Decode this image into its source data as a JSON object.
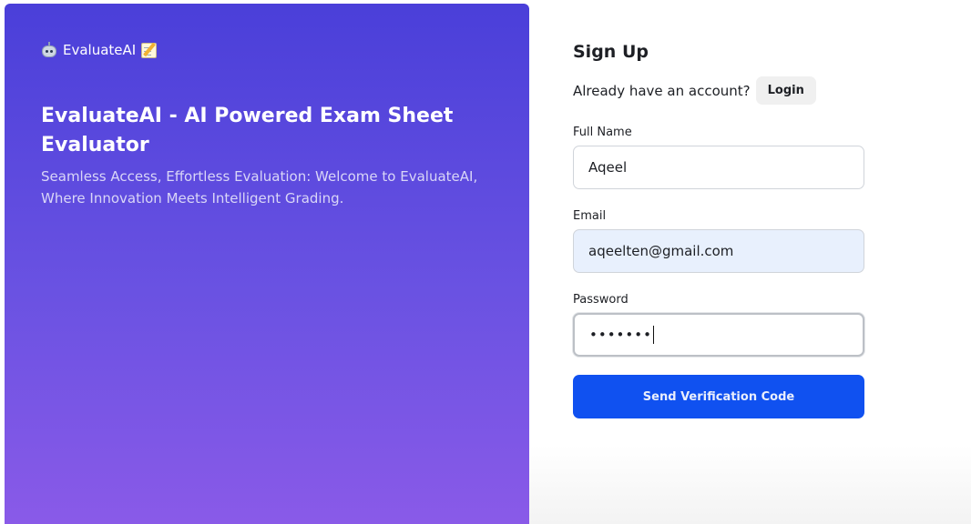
{
  "brand": {
    "name": "EvaluateAI",
    "left_icon": "robot-icon",
    "right_icon": "memo-icon"
  },
  "hero": {
    "title": "EvaluateAI - AI Powered Exam Sheet Evaluator",
    "subtitle": "Seamless Access, Effortless Evaluation: Welcome to EvaluateAI, Where Innovation Meets Intelligent Grading."
  },
  "form": {
    "title": "Sign Up",
    "account_prompt": "Already have an account?",
    "login_label": "Login",
    "full_name": {
      "label": "Full Name",
      "value": "Aqeel"
    },
    "email": {
      "label": "Email",
      "value": "aqeelten@gmail.com"
    },
    "password": {
      "label": "Password",
      "masked_value": "•••••••"
    },
    "submit_label": "Send Verification Code"
  },
  "colors": {
    "gradient_top": "#4a3fd9",
    "gradient_bottom": "#8a5ae8",
    "primary_button": "#1051f0",
    "autofill_bg": "#e8f0fd"
  }
}
